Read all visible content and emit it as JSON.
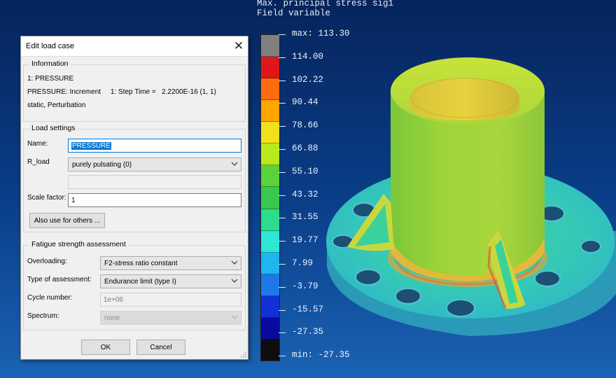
{
  "legend": {
    "title_line1": "Max. principal stress sig1",
    "title_line2": "Field variable",
    "max_label": "max: 113.30",
    "min_label": "min: -27.35",
    "ticks": [
      "114.00",
      "102.22",
      "90.44",
      "78.66",
      "66.88",
      "55.10",
      "43.32",
      "31.55",
      "19.77",
      "7.99",
      "-3.79",
      "-15.57",
      "-27.35"
    ],
    "colors": [
      "#808080",
      "#e0171a",
      "#ff6a10",
      "#ffa500",
      "#f2e01b",
      "#b9ea1e",
      "#58d43a",
      "#38c84e",
      "#2ddd8c",
      "#2ee6d6",
      "#1fb6f0",
      "#1e78e8",
      "#1330d8",
      "#0a0a9e",
      "#0e0e10"
    ]
  },
  "dialog": {
    "title": "Edit load case",
    "close_glyph": "✕",
    "information": {
      "title": "Information",
      "line1": "1: PRESSURE",
      "line2": "PRESSURE: Increment     1: Step Time =   2.2200E-16 (1, 1)",
      "line3": "static, Perturbation"
    },
    "load_settings": {
      "title": "Load settings",
      "name_label": "Name:",
      "name_value": "PRESSURE",
      "rload_label": "R_load",
      "rload_value": "purely pulsating (0)",
      "scale_label": "Scale factor:",
      "scale_value": "1",
      "also_use_button": "Also use for others ..."
    },
    "fatigue": {
      "title": "Fatigue strength assessment",
      "overloading_label": "Overloading:",
      "overloading_value": "F2-stress ratio constant",
      "assessment_label": "Type of assessment:",
      "assessment_value": "Endurance limit (type I)",
      "cycle_label": "Cycle number:",
      "cycle_value": "1e+06",
      "spectrum_label": "Spectrum:",
      "spectrum_value": "none"
    },
    "ok_button": "OK",
    "cancel_button": "Cancel"
  },
  "model": {
    "icon": "flange-fem-model"
  }
}
